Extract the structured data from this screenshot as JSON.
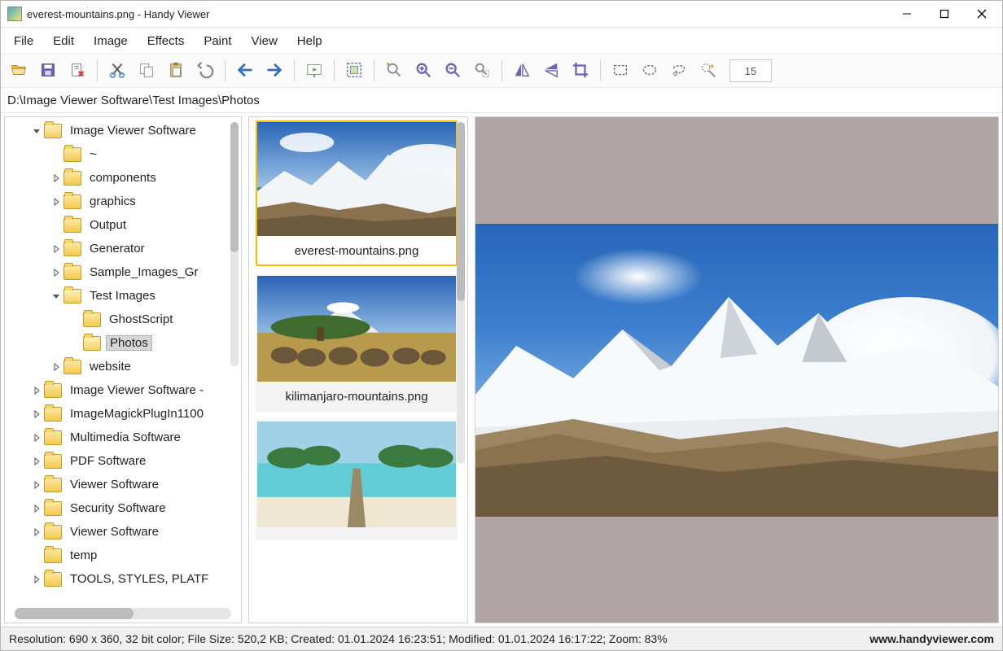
{
  "titlebar": {
    "title": "everest-mountains.png - Handy Viewer"
  },
  "menu": {
    "items": [
      "File",
      "Edit",
      "Image",
      "Effects",
      "Paint",
      "View",
      "Help"
    ]
  },
  "toolbar": {
    "buttons": [
      "open",
      "save",
      "delete",
      "sep",
      "cut",
      "copy",
      "paste",
      "undo",
      "sep",
      "prev",
      "next",
      "sep",
      "slideshow",
      "sep",
      "fullscreen",
      "sep",
      "zoom-fit",
      "zoom-in",
      "zoom-out",
      "zoom-region",
      "sep",
      "flip-h",
      "flip-v",
      "crop",
      "sep",
      "select-rect",
      "select-ellipse",
      "select-lasso",
      "select-wand"
    ],
    "input_value": "15"
  },
  "path": "D:\\Image Viewer Software\\Test Images\\Photos",
  "tree": {
    "rows": [
      {
        "depth": 1,
        "exp": "open",
        "label": "Image Viewer Software",
        "open": true
      },
      {
        "depth": 2,
        "exp": "",
        "label": "~"
      },
      {
        "depth": 2,
        "exp": "closed",
        "label": "components"
      },
      {
        "depth": 2,
        "exp": "closed",
        "label": "graphics"
      },
      {
        "depth": 2,
        "exp": "",
        "label": "Output"
      },
      {
        "depth": 2,
        "exp": "closed",
        "label": "Generator"
      },
      {
        "depth": 2,
        "exp": "closed",
        "label": "Sample_Images_Gr"
      },
      {
        "depth": 2,
        "exp": "open",
        "label": "Test Images",
        "open": true
      },
      {
        "depth": 3,
        "exp": "",
        "label": "GhostScript"
      },
      {
        "depth": 3,
        "exp": "",
        "label": "Photos",
        "selected": true,
        "open": true
      },
      {
        "depth": 2,
        "exp": "closed",
        "label": "website"
      },
      {
        "depth": 1,
        "exp": "closed",
        "label": "Image Viewer Software -"
      },
      {
        "depth": 1,
        "exp": "closed",
        "label": "ImageMagickPlugIn1100"
      },
      {
        "depth": 1,
        "exp": "closed",
        "label": "Multimedia Software"
      },
      {
        "depth": 1,
        "exp": "closed",
        "label": "PDF Software"
      },
      {
        "depth": 1,
        "exp": "closed",
        "label": "Viewer Software"
      },
      {
        "depth": 1,
        "exp": "closed",
        "label": "Security  Software"
      },
      {
        "depth": 1,
        "exp": "closed",
        "label": "Viewer Software"
      },
      {
        "depth": 1,
        "exp": "",
        "label": "temp"
      },
      {
        "depth": 1,
        "exp": "closed",
        "label": "TOOLS, STYLES, PLATF"
      }
    ]
  },
  "thumbs": [
    {
      "label": "everest-mountains.png",
      "selected": true,
      "kind": "mountain"
    },
    {
      "label": "kilimanjaro-mountains.png",
      "selected": false,
      "kind": "savanna"
    },
    {
      "label": "",
      "selected": false,
      "kind": "beach"
    }
  ],
  "status": {
    "text": "Resolution: 690 x 360, 32 bit color; File Size: 520,2 KB; Created: 01.01.2024 16:23:51; Modified: 01.01.2024 16:17:22; Zoom: 83%",
    "site": "www.handyviewer.com"
  }
}
